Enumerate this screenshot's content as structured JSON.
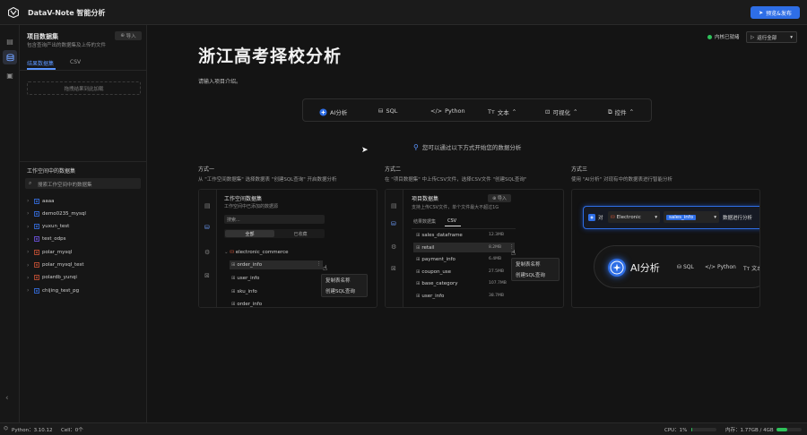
{
  "app": {
    "title": "DataV-Note 智能分析",
    "publish_label": "预览&发布"
  },
  "sidebar": {
    "dataset_title": "项目数据集",
    "dataset_subtitle": "包含查询产出的数据集及上传的文件",
    "import_label": "导入",
    "tabs": [
      "结果数据集",
      "CSV"
    ],
    "dropzone_text": "拖拽结果到此加载",
    "workspace_title": "工作空间中的数据集",
    "search_placeholder": "搜索工作空间中的数据集",
    "items": [
      {
        "label": "aaaa",
        "color": "#3b7cff"
      },
      {
        "label": "demo0235_mysql",
        "color": "#3b7cff"
      },
      {
        "label": "yuxun_test",
        "color": "#3b7cff"
      },
      {
        "label": "test_odps",
        "color": "#7b5cff"
      },
      {
        "label": "polar_mysql",
        "color": "#e05a3a"
      },
      {
        "label": "polar_mysql_test",
        "color": "#e05a3a"
      },
      {
        "label": "polardb_yunqi",
        "color": "#e05a3a"
      },
      {
        "label": "chijing_test_pg",
        "color": "#3b7cff"
      }
    ]
  },
  "main": {
    "title": "浙江高考择校分析",
    "description": "请输入项目介绍。",
    "status_text": "内核已就绪",
    "run_all_label": "运行全部",
    "toolbar": [
      {
        "label": "AI分析",
        "icon": "ai-icon"
      },
      {
        "label": "SQL",
        "icon": "database-icon"
      },
      {
        "label": "Python",
        "icon": "code-icon"
      },
      {
        "label": "文本",
        "icon": "text-icon"
      },
      {
        "label": "可视化",
        "icon": "chart-icon"
      },
      {
        "label": "控件",
        "icon": "widget-icon"
      }
    ],
    "hint": "您可以通过以下方式开始您的数据分析",
    "methods": [
      {
        "label": "方式一",
        "desc": "从 \"工作空间数据集\" 选择数据表 \"创建SQL查询\" 开启数据分析",
        "panel_title": "工作空间数据集",
        "panel_sub": "工作空间中已添加的数据源",
        "search": "搜索...",
        "tabs": [
          "全部",
          "已收藏"
        ],
        "db": "electronic_commerce",
        "tables": [
          "order_info",
          "user_info",
          "sku_info",
          "order_info"
        ],
        "menu": [
          "复制表名称",
          "创建SQL查询"
        ]
      },
      {
        "label": "方式二",
        "desc": "在 \"项目数据集\" 中上传CSV文件，选择CSV文件 \"创建SQL查询\"",
        "panel_title": "项目数据集",
        "panel_sub": "支持上传CSV文件，单个文件最大不超过1G",
        "import": "导入",
        "tabs": [
          "结果数据集",
          "CSV"
        ],
        "rows": [
          {
            "name": "sales_dataframe",
            "size": "12.3MB"
          },
          {
            "name": "retail",
            "size": "8.2MB"
          },
          {
            "name": "payment_info",
            "size": "6.4MB"
          },
          {
            "name": "coupon_use",
            "size": "27.5MB"
          },
          {
            "name": "base_category",
            "size": "107.7MB"
          },
          {
            "name": "user_info",
            "size": "38.7MB"
          }
        ],
        "menu": [
          "复制表名称",
          "创建SQL查询"
        ]
      },
      {
        "label": "方式三",
        "desc": "使用 \"AI分析\" 对现有中的数据表进行智能分析",
        "prefix": "对",
        "db": "Electronic",
        "table": "sales_info",
        "suffix": "数据进行分析",
        "ai_label": "AI分析",
        "chips": [
          "SQL",
          "Python",
          "文本"
        ]
      }
    ]
  },
  "bottom": {
    "python": "Python：3.10.12",
    "cell": "Cell：0个",
    "cpu": "CPU：1%",
    "mem": "内存：1.77GB / 4GB"
  }
}
